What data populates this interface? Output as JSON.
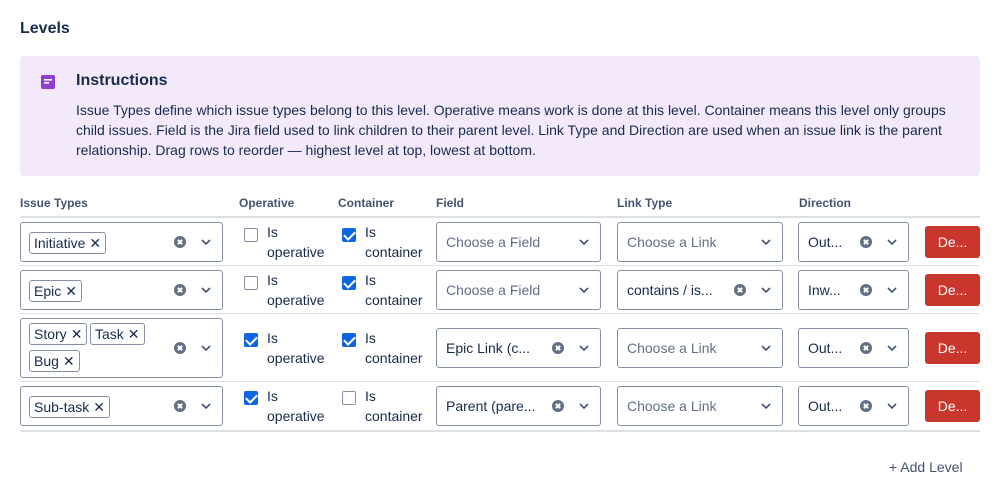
{
  "section_title": "Levels",
  "instructions": {
    "icon": "note-icon",
    "title": "Instructions",
    "body": "Issue Types define which issue types belong to this level. Operative means work is done at this level. Container means this level only groups child issues. Field is the Jira field used to link children to their parent level. Link Type and Direction are used when an issue link is the parent relationship. Drag rows to reorder — highest level at top, lowest at bottom."
  },
  "columns": {
    "issue_types": "Issue Types",
    "operative": "Operative",
    "container": "Container",
    "field": "Field",
    "link_type": "Link Type",
    "direction": "Direction"
  },
  "labels": {
    "is": "Is",
    "operative": "operative",
    "container": "container",
    "field_placeholder": "Choose a Field",
    "link_placeholder": "Choose a Link",
    "delete": "De...",
    "add_level": "+ Add Level"
  },
  "rows": [
    {
      "issue_types": [
        "Initiative"
      ],
      "operative": false,
      "container": true,
      "field": "",
      "link_type": "",
      "direction": "Out..."
    },
    {
      "issue_types": [
        "Epic"
      ],
      "operative": false,
      "container": true,
      "field": "",
      "link_type": "contains / is...",
      "direction": "Inw..."
    },
    {
      "issue_types": [
        "Story",
        "Task",
        "Bug"
      ],
      "operative": true,
      "container": true,
      "field": "Epic Link (c...",
      "link_type": "",
      "direction": "Out..."
    },
    {
      "issue_types": [
        "Sub-task"
      ],
      "operative": true,
      "container": false,
      "field": "Parent (pare...",
      "link_type": "",
      "direction": "Out..."
    }
  ],
  "colors": {
    "accent": "#0c66e4",
    "danger": "#c9372c",
    "info_bg": "#f3e9fb",
    "info_icon": "#8f3fd1"
  }
}
